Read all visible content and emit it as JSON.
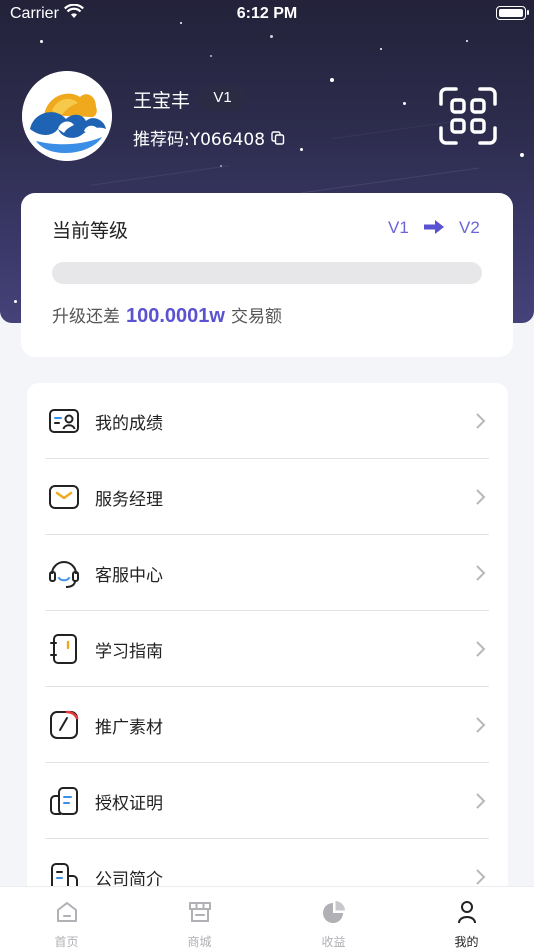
{
  "status_bar": {
    "carrier": "Carrier",
    "time": "6:12 PM"
  },
  "profile": {
    "name": "王宝丰",
    "level_badge": "V1",
    "referral": "推荐码:Y066408"
  },
  "level_card": {
    "title": "当前等级",
    "from_level": "V1",
    "to_level": "V2",
    "progress_fraction": 0,
    "upgrade_prefix": "升级还差",
    "upgrade_amount": "100.0001w",
    "upgrade_suffix": "交易额"
  },
  "menu": {
    "items": [
      {
        "label": "我的成绩",
        "icon": "score-card-icon"
      },
      {
        "label": "服务经理",
        "icon": "envelope-icon"
      },
      {
        "label": "客服中心",
        "icon": "headset-icon"
      },
      {
        "label": "学习指南",
        "icon": "notebook-icon"
      },
      {
        "label": "推广素材",
        "icon": "gauge-icon"
      },
      {
        "label": "授权证明",
        "icon": "certificate-icon"
      },
      {
        "label": "公司简介",
        "icon": "building-icon"
      }
    ]
  },
  "tabs": [
    {
      "label": "首页",
      "icon": "home-icon",
      "active": false
    },
    {
      "label": "商城",
      "icon": "store-icon",
      "active": false
    },
    {
      "label": "收益",
      "icon": "pie-chart-icon",
      "active": false
    },
    {
      "label": "我的",
      "icon": "person-icon",
      "active": true
    }
  ],
  "colors": {
    "accent": "#6a63d9",
    "header_dark": "#2a2945",
    "icon_accent_yellow": "#f0a81c",
    "icon_accent_blue": "#3a8ee6",
    "icon_accent_red": "#e33b3b"
  }
}
